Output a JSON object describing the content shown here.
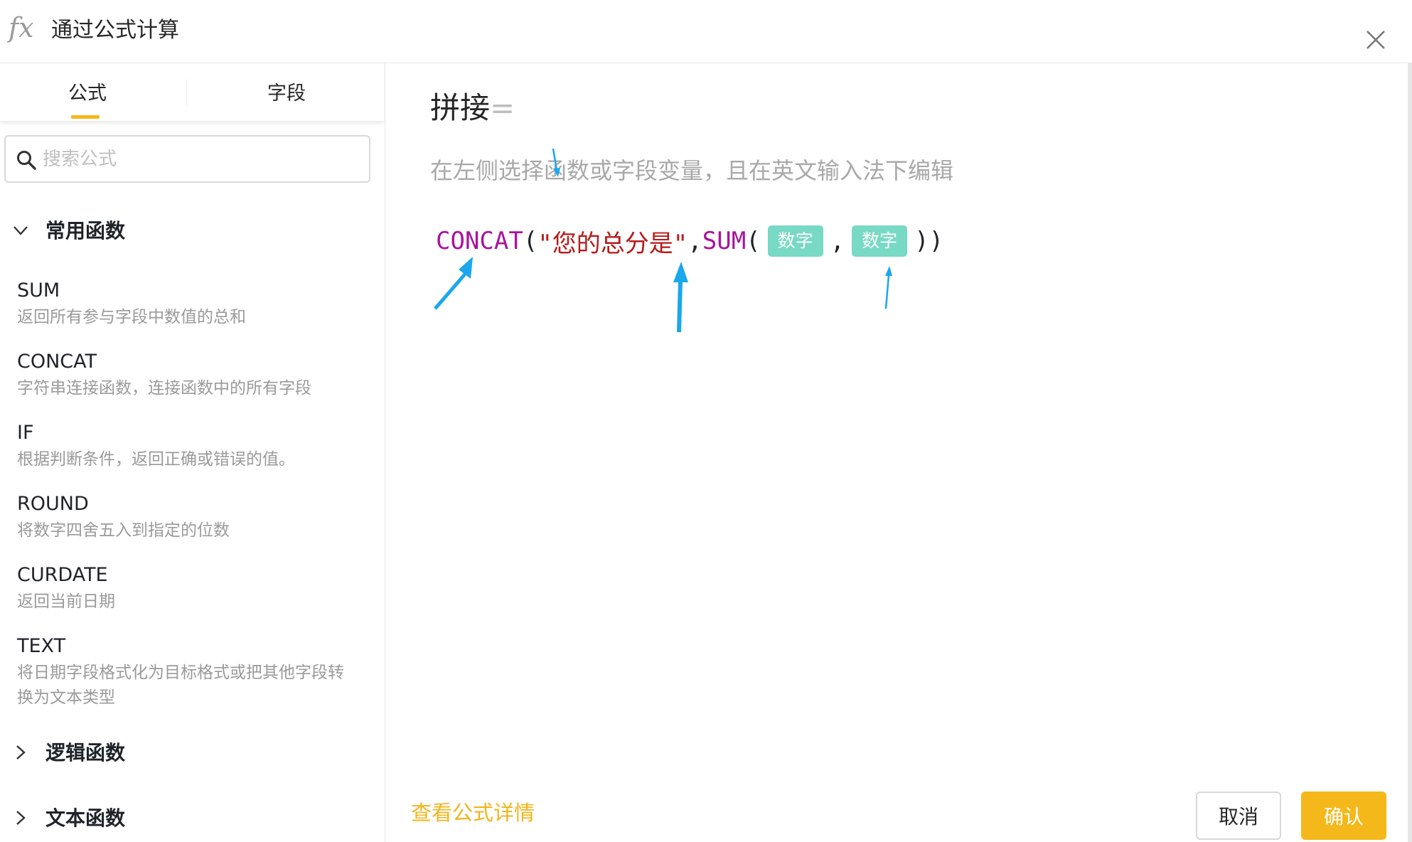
{
  "header": {
    "icon": "fx-icon",
    "title": "通过公式计算",
    "close_icon": "close-icon"
  },
  "tabs": [
    {
      "label": "公式",
      "active": true
    },
    {
      "label": "字段",
      "active": false
    }
  ],
  "search": {
    "placeholder": "搜索公式",
    "value": ""
  },
  "groups": [
    {
      "label": "常用函数",
      "expanded": true,
      "items": [
        {
          "name": "SUM",
          "desc": "返回所有参与字段中数值的总和"
        },
        {
          "name": "CONCAT",
          "desc": "字符串连接函数，连接函数中的所有字段"
        },
        {
          "name": "IF",
          "desc": "根据判断条件，返回正确或错误的值。"
        },
        {
          "name": "ROUND",
          "desc": "将数字四舍五入到指定的位数"
        },
        {
          "name": "CURDATE",
          "desc": "返回当前日期"
        },
        {
          "name": "TEXT",
          "desc": "将日期字段格式化为目标格式或把其他字段转换为文本类型"
        }
      ]
    },
    {
      "label": "逻辑函数",
      "expanded": false
    },
    {
      "label": "文本函数",
      "expanded": false
    }
  ],
  "editor": {
    "field_name": "拼接",
    "equals": "=",
    "hint": "在左侧选择函数或字段变量，且在英文输入法下编辑",
    "formula": {
      "fn1": "CONCAT",
      "open1": "(",
      "string": "\"您的总分是\"",
      "comma1": ",",
      "fn2": "SUM",
      "open2": "(",
      "tag1": "数字",
      "comma2": ",",
      "tag2": "数字",
      "close": "))"
    }
  },
  "footer": {
    "details_link": "查看公式详情",
    "cancel": "取消",
    "confirm": "确认"
  },
  "colors": {
    "accent": "#f5b81a",
    "function": "#a8149b",
    "string": "#b51b1b",
    "tag": "#78d9c4",
    "annotation_arrow": "#1aa7ec"
  }
}
